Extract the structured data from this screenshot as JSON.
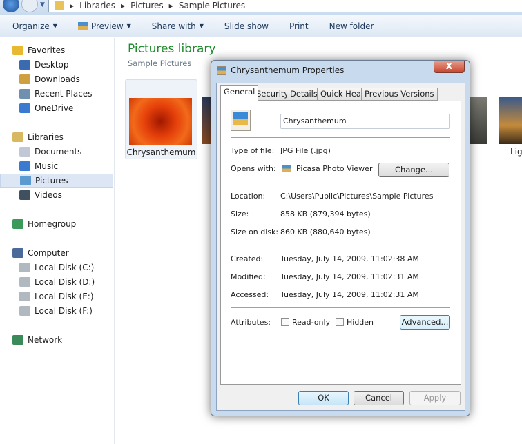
{
  "address": {
    "crumbs": [
      "Libraries",
      "Pictures",
      "Sample Pictures"
    ]
  },
  "toolbar": {
    "organize": "Organize",
    "preview": "Preview",
    "share": "Share with",
    "slideshow": "Slide show",
    "print": "Print",
    "new_folder": "New folder"
  },
  "sidebar": {
    "items": [
      {
        "label": "Favorites",
        "icon": "star-icon"
      },
      {
        "label": "Desktop",
        "icon": "desktop-icon"
      },
      {
        "label": "Downloads",
        "icon": "downloads-icon"
      },
      {
        "label": "Recent Places",
        "icon": "recent-places-icon"
      },
      {
        "label": "OneDrive",
        "icon": "onedrive-icon"
      },
      {
        "label": "Libraries",
        "icon": "libraries-icon"
      },
      {
        "label": "Documents",
        "icon": "documents-icon"
      },
      {
        "label": "Music",
        "icon": "music-icon"
      },
      {
        "label": "Pictures",
        "icon": "pictures-icon",
        "selected": true
      },
      {
        "label": "Videos",
        "icon": "videos-icon"
      },
      {
        "label": "Homegroup",
        "icon": "homegroup-icon"
      },
      {
        "label": "Computer",
        "icon": "computer-icon"
      },
      {
        "label": "Local Disk (C:)",
        "icon": "drive-icon"
      },
      {
        "label": "Local Disk (D:)",
        "icon": "drive-icon"
      },
      {
        "label": "Local Disk (E:)",
        "icon": "drive-icon"
      },
      {
        "label": "Local Disk (F:)",
        "icon": "drive-icon"
      },
      {
        "label": "Network",
        "icon": "network-icon"
      }
    ]
  },
  "content": {
    "title": "Pictures library",
    "subtitle": "Sample Pictures",
    "items": [
      {
        "label": "Chrysanthemum"
      },
      {
        "label": "Lig"
      }
    ]
  },
  "dialog": {
    "title": "Chrysanthemum Properties",
    "close": "X",
    "tabs": [
      "General",
      "Security",
      "Details",
      "Quick Heal",
      "Previous Versions"
    ],
    "name_value": "Chrysanthemum",
    "type_label": "Type of file:",
    "type_value": "JPG File (.jpg)",
    "opens_label": "Opens with:",
    "opens_value": "Picasa Photo Viewer",
    "change": "Change...",
    "location_label": "Location:",
    "location_value": "C:\\Users\\Public\\Pictures\\Sample Pictures",
    "size_label": "Size:",
    "size_value": "858 KB (879,394 bytes)",
    "disk_label": "Size on disk:",
    "disk_value": "860 KB (880,640 bytes)",
    "created_label": "Created:",
    "created_value": "Tuesday, July 14, 2009, 11:02:38 AM",
    "modified_label": "Modified:",
    "modified_value": "Tuesday, July 14, 2009, 11:02:31 AM",
    "accessed_label": "Accessed:",
    "accessed_value": "Tuesday, July 14, 2009, 11:02:31 AM",
    "attributes_label": "Attributes:",
    "readonly": "Read-only",
    "hidden": "Hidden",
    "advanced": "Advanced...",
    "ok": "OK",
    "cancel": "Cancel",
    "apply": "Apply"
  }
}
